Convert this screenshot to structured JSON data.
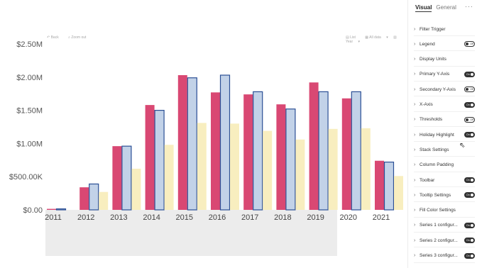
{
  "toolbar": {
    "back_label": "Back",
    "zoom_label": "Zoom out",
    "list_label": "List",
    "filter_label": "All data",
    "year_label": "Year"
  },
  "panel": {
    "tabs": [
      {
        "label": "Visual",
        "active": true
      },
      {
        "label": "General",
        "active": false
      }
    ],
    "more_label": "···",
    "items": [
      {
        "label": "Filter Trigger",
        "toggle": null
      },
      {
        "label": "Legend",
        "toggle": "Off"
      },
      {
        "label": "Display Units",
        "toggle": null
      },
      {
        "label": "Primary Y-Axis",
        "toggle": "On"
      },
      {
        "label": "Secondary Y-Axis",
        "toggle": "Off"
      },
      {
        "label": "X-Axis",
        "toggle": "On"
      },
      {
        "label": "Thresholds",
        "toggle": "Off"
      },
      {
        "label": "Holiday Highlight",
        "toggle": "On"
      },
      {
        "label": "Stack Settings",
        "toggle": null
      },
      {
        "label": "Column Padding",
        "toggle": null
      },
      {
        "label": "Toolbar",
        "toggle": "On"
      },
      {
        "label": "Tooltip Settings",
        "toggle": "On"
      },
      {
        "label": "Fill Color Settings",
        "toggle": null
      },
      {
        "label": "Series 1 configur...",
        "toggle": "On"
      },
      {
        "label": "Series 2 configur...",
        "toggle": "On"
      },
      {
        "label": "Series 3 configur...",
        "toggle": "On"
      }
    ]
  },
  "colors": {
    "series1": "#d94873",
    "series2_fill": "#c2d2e8",
    "series2_stroke": "#2b4f95",
    "series3": "#f8eebf",
    "x_band": "#ececec"
  },
  "chart_data": {
    "type": "bar",
    "categories": [
      "2011",
      "2012",
      "2013",
      "2014",
      "2015",
      "2016",
      "2017",
      "2018",
      "2019",
      "2020",
      "2021"
    ],
    "series": [
      {
        "values": [
          15000,
          340000,
          960000,
          1580000,
          2030000,
          1770000,
          1740000,
          1590000,
          1920000,
          1680000,
          740000
        ]
      },
      {
        "values": [
          15000,
          390000,
          960000,
          1500000,
          1990000,
          2030000,
          1780000,
          1520000,
          1780000,
          1780000,
          720000
        ]
      },
      {
        "values": [
          0,
          270000,
          620000,
          980000,
          1310000,
          1300000,
          1190000,
          1060000,
          1220000,
          1230000,
          510000
        ]
      }
    ],
    "yticks": [
      "$0.00",
      "$500.00K",
      "$1.00M",
      "$1.50M",
      "$2.00M",
      "$2.50M"
    ],
    "ylim": [
      0,
      2500000
    ],
    "grid": false,
    "legend": "hidden"
  }
}
